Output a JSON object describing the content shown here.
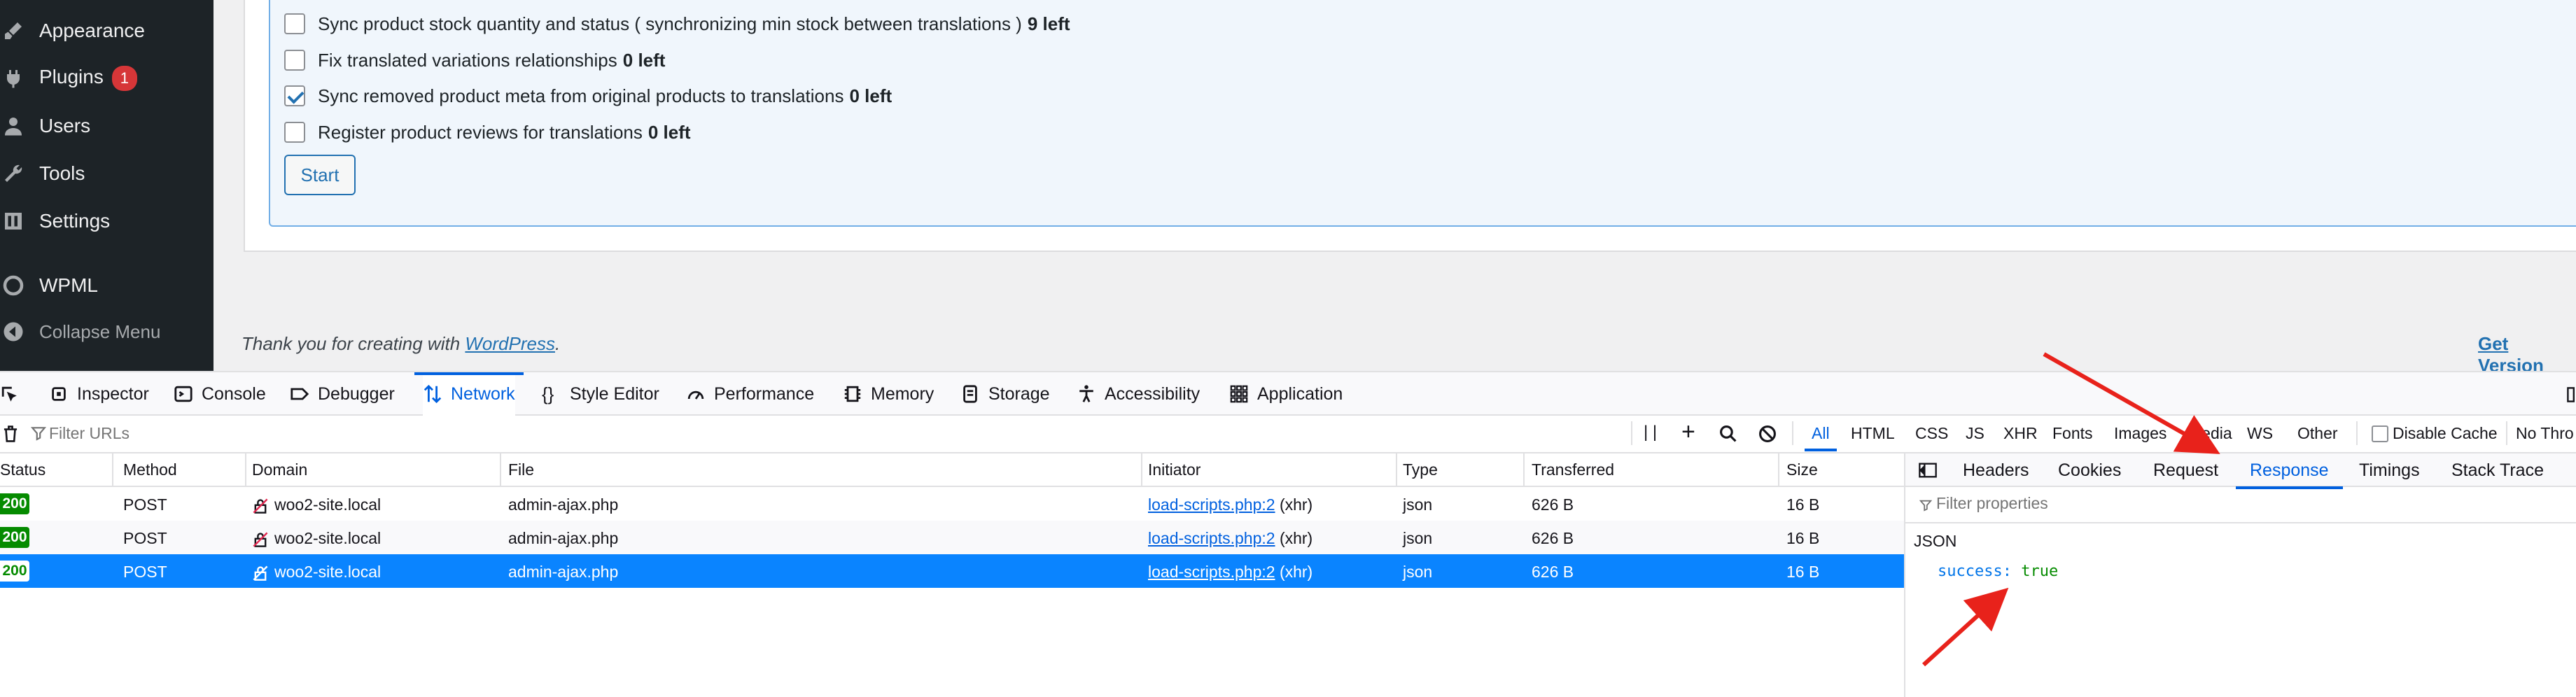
{
  "sidebar": {
    "items": [
      {
        "label": "Appearance",
        "icon": "paintbrush-icon"
      },
      {
        "label": "Plugins",
        "icon": "plugin-icon",
        "badge": "1"
      },
      {
        "label": "Users",
        "icon": "users-icon"
      },
      {
        "label": "Tools",
        "icon": "wrench-icon"
      },
      {
        "label": "Settings",
        "icon": "settings-icon"
      },
      {
        "label": "WPML",
        "icon": "wpml-icon"
      },
      {
        "label": "Collapse Menu",
        "icon": "collapse-icon"
      }
    ]
  },
  "options": [
    {
      "text": "Sync product stock quantity and status ( synchronizing min stock between translations )",
      "count": "9 left",
      "checked": false
    },
    {
      "text": "Fix translated variations relationships",
      "count": "0 left",
      "checked": false
    },
    {
      "text": "Sync removed product meta from original products to translations",
      "count": "0 left",
      "checked": true
    },
    {
      "text": "Register product reviews for translations",
      "count": "0 left",
      "checked": false
    }
  ],
  "start_label": "Start",
  "footer": {
    "prefix": "Thank you for creating with ",
    "link": "WordPress",
    "suffix": ".",
    "get_version": "Get Version"
  },
  "devtools": {
    "tabs": [
      "Inspector",
      "Console",
      "Debugger",
      "Network",
      "Style Editor",
      "Performance",
      "Memory",
      "Storage",
      "Accessibility",
      "Application"
    ],
    "active_tab": "Network",
    "filter_placeholder": "Filter URLs",
    "type_filters": [
      "All",
      "HTML",
      "CSS",
      "JS",
      "XHR",
      "Fonts",
      "Images",
      "Media",
      "WS",
      "Other"
    ],
    "disable_cache": "Disable Cache",
    "throttle": "No Thro",
    "columns": [
      "Status",
      "Method",
      "Domain",
      "File",
      "Initiator",
      "Type",
      "Transferred",
      "Size"
    ],
    "rows": [
      {
        "status": "200",
        "method": "POST",
        "domain": "woo2-site.local",
        "file": "admin-ajax.php",
        "initiator": "load-scripts.php:2",
        "initiator_suffix": "(xhr)",
        "type": "json",
        "transferred": "626 B",
        "size": "16 B"
      },
      {
        "status": "200",
        "method": "POST",
        "domain": "woo2-site.local",
        "file": "admin-ajax.php",
        "initiator": "load-scripts.php:2",
        "initiator_suffix": "(xhr)",
        "type": "json",
        "transferred": "626 B",
        "size": "16 B"
      },
      {
        "status": "200",
        "method": "POST",
        "domain": "woo2-site.local",
        "file": "admin-ajax.php",
        "initiator": "load-scripts.php:2",
        "initiator_suffix": "(xhr)",
        "type": "json",
        "transferred": "626 B",
        "size": "16 B"
      }
    ],
    "side_tabs": [
      "Headers",
      "Cookies",
      "Request",
      "Response",
      "Timings",
      "Stack Trace"
    ],
    "active_side_tab": "Response",
    "filter_properties": "Filter properties",
    "json_label": "JSON",
    "json_key": "success:",
    "json_value": "true"
  },
  "colors": {
    "accent": "#0060df",
    "selected_row": "#0a84ff",
    "status_ok": "#058b00",
    "arrow": "#e8221b",
    "wp_sidebar": "#1d2327"
  }
}
